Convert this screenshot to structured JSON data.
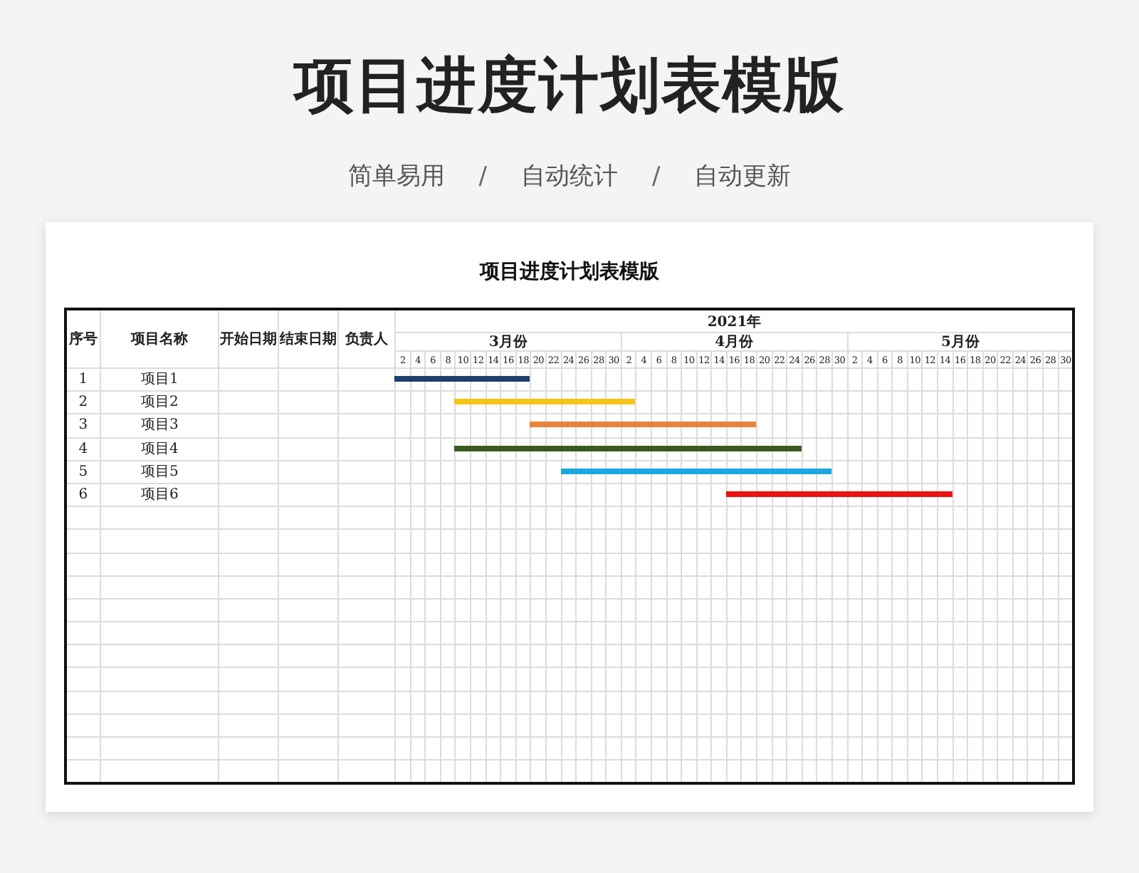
{
  "title": "项目进度计划表模版",
  "subtitle": [
    "简单易用",
    "/",
    "自动统计",
    "/",
    "自动更新"
  ],
  "sheet": {
    "title": "项目进度计划表模版",
    "columns": [
      "序号",
      "项目名称",
      "开始日期",
      "结束日期",
      "负责人"
    ],
    "year": "2021年",
    "months": [
      {
        "label": "3月份",
        "days": [
          "2",
          "4",
          "6",
          "8",
          "10",
          "12",
          "14",
          "16",
          "18",
          "20",
          "22",
          "24",
          "26",
          "28",
          "30"
        ]
      },
      {
        "label": "4月份",
        "days": [
          "2",
          "4",
          "6",
          "8",
          "10",
          "12",
          "14",
          "16",
          "18",
          "20",
          "22",
          "24",
          "26",
          "28",
          "30"
        ]
      },
      {
        "label": "5月份",
        "days": [
          "2",
          "4",
          "6",
          "8",
          "10",
          "12",
          "14",
          "16",
          "18",
          "20",
          "22",
          "24",
          "26",
          "28",
          "30"
        ]
      }
    ],
    "rows": [
      {
        "no": "1",
        "name": "项目1",
        "color": "#1f3f6b",
        "timeline": [
          true,
          true,
          true,
          true,
          true,
          true,
          true,
          true,
          true,
          false,
          false,
          false,
          false,
          false,
          false,
          false,
          false,
          false,
          false,
          false,
          false,
          false,
          false,
          false,
          false,
          false,
          false,
          false,
          false,
          false,
          false,
          false,
          false,
          false,
          false,
          false,
          false,
          false,
          false,
          false,
          false,
          false,
          false,
          false,
          false
        ]
      },
      {
        "no": "2",
        "name": "项目2",
        "color": "#f5c518",
        "timeline": [
          false,
          false,
          false,
          false,
          true,
          true,
          true,
          true,
          true,
          true,
          true,
          true,
          true,
          true,
          true,
          true,
          false,
          false,
          false,
          false,
          false,
          false,
          false,
          false,
          false,
          false,
          false,
          false,
          false,
          false,
          false,
          false,
          false,
          false,
          false,
          false,
          false,
          false,
          false,
          false,
          false,
          false,
          false,
          false,
          false
        ]
      },
      {
        "no": "3",
        "name": "项目3",
        "color": "#e8833a",
        "timeline": [
          false,
          false,
          false,
          false,
          false,
          false,
          false,
          false,
          false,
          true,
          true,
          true,
          true,
          true,
          true,
          true,
          true,
          true,
          true,
          true,
          true,
          true,
          true,
          true,
          false,
          false,
          false,
          false,
          false,
          false,
          false,
          false,
          false,
          false,
          false,
          false,
          false,
          false,
          false,
          false,
          false,
          false,
          false,
          false,
          false
        ]
      },
      {
        "no": "4",
        "name": "项目4",
        "color": "#3a5a1f",
        "timeline": [
          false,
          false,
          false,
          false,
          true,
          true,
          true,
          true,
          true,
          true,
          true,
          true,
          true,
          true,
          true,
          true,
          true,
          true,
          true,
          true,
          true,
          true,
          true,
          true,
          true,
          true,
          true,
          false,
          false,
          false,
          false,
          false,
          false,
          false,
          false,
          false,
          false,
          false,
          false,
          false,
          false,
          false,
          false,
          false,
          false
        ]
      },
      {
        "no": "5",
        "name": "项目5",
        "color": "#1aa8e0",
        "timeline": [
          false,
          false,
          false,
          false,
          false,
          false,
          false,
          false,
          false,
          false,
          false,
          true,
          true,
          true,
          true,
          true,
          true,
          true,
          true,
          true,
          true,
          true,
          true,
          true,
          true,
          true,
          true,
          true,
          true,
          false,
          false,
          false,
          false,
          false,
          false,
          false,
          false,
          false,
          false,
          false,
          false,
          false,
          false,
          false,
          false
        ]
      },
      {
        "no": "6",
        "name": "项目6",
        "color": "#ee1111",
        "timeline": [
          false,
          false,
          false,
          false,
          false,
          false,
          false,
          false,
          false,
          false,
          false,
          false,
          false,
          false,
          false,
          false,
          false,
          false,
          false,
          false,
          false,
          false,
          true,
          true,
          true,
          true,
          true,
          true,
          true,
          true,
          true,
          true,
          true,
          true,
          true,
          true,
          true,
          false,
          false,
          false,
          false,
          false,
          false,
          false,
          false
        ]
      }
    ]
  }
}
